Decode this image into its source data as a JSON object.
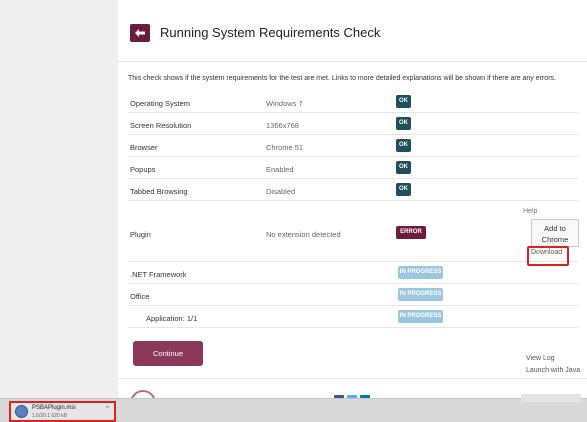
{
  "header": {
    "title": "Running System Requirements Check"
  },
  "intro": "This check shows if the system requirements for the test are met. Links to more detailed explanations will be shown if there are any errors.",
  "rows": [
    {
      "label": "Operating System",
      "value": "Windows 7",
      "status": "OK",
      "type": "ok"
    },
    {
      "label": "Screen Resolution",
      "value": "1366x768",
      "status": "OK",
      "type": "ok"
    },
    {
      "label": "Browser",
      "value": "Chrome 51",
      "status": "OK",
      "type": "ok"
    },
    {
      "label": "Popups",
      "value": "Enabled",
      "status": "OK",
      "type": "ok"
    },
    {
      "label": "Tabbed Browsing",
      "value": "Disabled",
      "status": "OK",
      "type": "ok"
    },
    {
      "label": "Plugin",
      "value": "No extension detected",
      "status": "ERROR",
      "type": "error"
    },
    {
      "label": ".NET Framework",
      "value": "",
      "status": "IN PROGRESS",
      "type": "progress"
    },
    {
      "label": "Office",
      "value": "",
      "status": "IN PROGRESS",
      "type": "progress"
    },
    {
      "label": "Application: 1/1",
      "value": "",
      "status": "IN PROGRESS",
      "type": "progress"
    }
  ],
  "plugin_actions": {
    "help": "Help",
    "add_to_chrome": "Add to Chrome",
    "download": "Download"
  },
  "continue_label": "Continue",
  "side_links": {
    "view_log": "View Log",
    "launch_java": "Launch with Java"
  },
  "download_bar": {
    "filename": "PSBAPlugin.msi",
    "size": "1.6/20.1 620 kB"
  },
  "colors": {
    "ok": "#1f4f5a",
    "error": "#6b1d3b",
    "progress": "#9cc6e0",
    "accent": "#8a3a58",
    "highlight": "#e02020"
  }
}
